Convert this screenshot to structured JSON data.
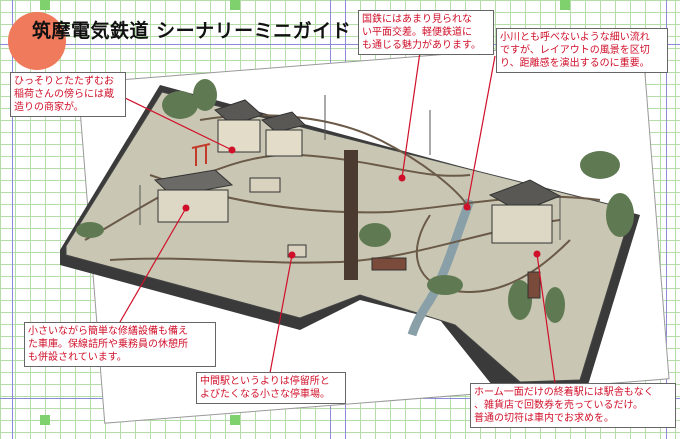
{
  "title": "筑摩電気鉄道 シーナリーミニガイド",
  "callouts": [
    {
      "lines": [
        "ひっそりとたたずむお",
        "稲荷さんの傍らには蔵",
        "造りの商家が。"
      ]
    },
    {
      "lines": [
        "国鉄にはあまり見られな",
        "い平面交差。軽便鉄道に",
        "も通じる魅力があります。"
      ]
    },
    {
      "lines": [
        "小川とも呼べないような細い流れ",
        "ですが、レイアウトの風景を区切",
        "り、距離感を演出するのに重要。"
      ]
    },
    {
      "lines": [
        "小さいながら簡単な修繕設備も備え",
        "た車庫。保線詰所や乗務員の休憩所",
        "も併設されています。"
      ]
    },
    {
      "lines": [
        "中間駅というよりは停留所と",
        "よびたくなる小さな停車場。"
      ]
    },
    {
      "lines": [
        "ホーム一面だけの終着駅には駅舎もなく",
        "、雑貨店で回数券を売っているだけ。",
        "普通の切符は車内でお求めを。"
      ]
    }
  ],
  "colors": {
    "callout_text": "#d0102a",
    "leader": "#d0102a",
    "grid": "#9ad48a",
    "accent_circle": "#f07a5c"
  }
}
